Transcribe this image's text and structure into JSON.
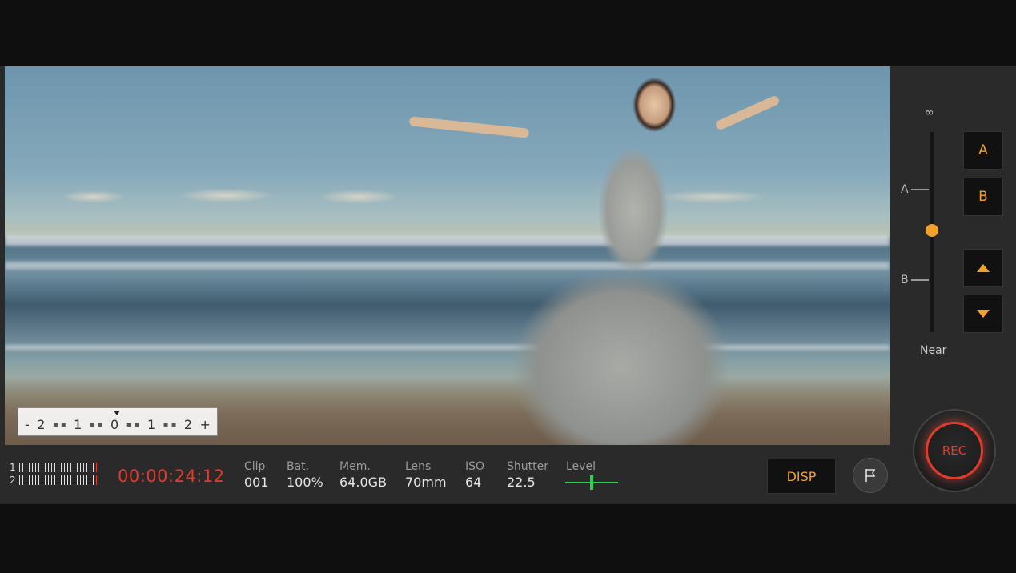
{
  "exposure_scale": {
    "labels": [
      "-",
      "2",
      "1",
      "0",
      "1",
      "2",
      "+"
    ]
  },
  "focus": {
    "far_label": "∞",
    "mark_a": "A",
    "mark_b": "B",
    "near_label": "Near"
  },
  "buttons": {
    "a": "A",
    "b": "B",
    "rec": "REC",
    "disp": "DISP",
    "up_icon": "triangle-up-icon",
    "down_icon": "triangle-down-icon",
    "flag_icon": "flag-icon"
  },
  "audio_meter": {
    "channels": [
      "1",
      "2"
    ]
  },
  "timecode": "00:00:24:12",
  "status": [
    {
      "label": "Clip",
      "value": "001"
    },
    {
      "label": "Bat.",
      "value": "100%"
    },
    {
      "label": "Mem.",
      "value": "64.0GB"
    },
    {
      "label": "Lens",
      "value": "70mm"
    },
    {
      "label": "ISO",
      "value": "64"
    },
    {
      "label": "Shutter",
      "value": "22.5"
    }
  ],
  "level": {
    "label": "Level"
  },
  "colors": {
    "accent": "#f2a12c",
    "record": "#e23b2b",
    "level": "#2bd24c"
  }
}
